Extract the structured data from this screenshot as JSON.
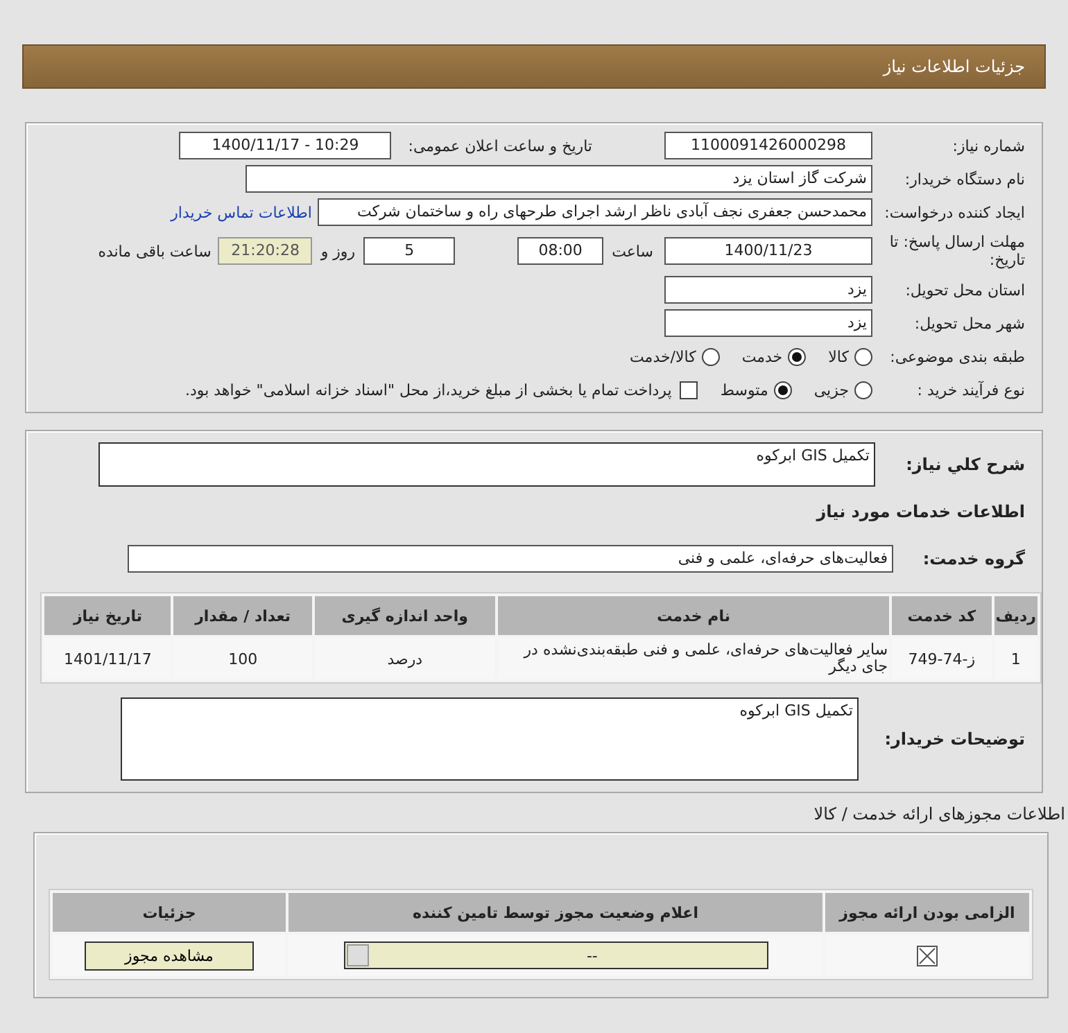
{
  "header": {
    "title": "جزئیات اطلاعات نیاز"
  },
  "details": {
    "need_number": {
      "label": "شماره نیاز:",
      "value": "1100091426000298"
    },
    "announce": {
      "label": "تاریخ و ساعت اعلان عمومی:",
      "value": "1400/11/17 - 10:29"
    },
    "buyer_org": {
      "label": "نام دستگاه خریدار:",
      "value": "شرکت گاز استان یزد"
    },
    "requester": {
      "label": "ایجاد کننده درخواست:",
      "value": "محمدحسن جعفری نجف آبادی ناظر ارشد اجرای طرحهای راه و ساختمان شرکت",
      "link": "اطلاعات تماس خریدار"
    },
    "deadline": {
      "label": "مهلت ارسال پاسخ: تا تاریخ:",
      "date": "1400/11/23",
      "time_label": "ساعت",
      "time": "08:00",
      "days": "5",
      "days_label": "روز و",
      "remaining": "21:20:28",
      "remaining_label": "ساعت باقی مانده"
    },
    "province": {
      "label": "استان محل تحویل:",
      "value": "یزد"
    },
    "city": {
      "label": "شهر محل تحویل:",
      "value": "یزد"
    },
    "category": {
      "label": "طبقه بندی موضوعی:",
      "options": [
        {
          "label": "کالا",
          "selected": false
        },
        {
          "label": "خدمت",
          "selected": true
        },
        {
          "label": "کالا/خدمت",
          "selected": false
        }
      ]
    },
    "process": {
      "label": "نوع فرآیند خرید :",
      "options": [
        {
          "label": "جزیی",
          "selected": false
        },
        {
          "label": "متوسط",
          "selected": true
        }
      ],
      "treasury": {
        "checked": false,
        "label": "پرداخت تمام یا بخشی از مبلغ خرید،از محل \"اسناد خزانه اسلامی\" خواهد بود."
      }
    }
  },
  "needs": {
    "summary": {
      "label": "شرح کلي نياز:",
      "value": "تکمیل GIS ابرکوه"
    },
    "heading": "اطلاعات خدمات مورد نیاز",
    "service_group": {
      "label": "گروه خدمت:",
      "value": "فعالیت‌های حرفه‌ای، علمی و فنی"
    },
    "table": {
      "columns": [
        "ردیف",
        "کد خدمت",
        "نام خدمت",
        "واحد اندازه گیری",
        "تعداد / مقدار",
        "تاریخ نیاز"
      ],
      "rows": [
        [
          "1",
          "ز-74-749",
          "سایر فعالیت‌های حرفه‌ای، علمی و فنی طبقه‌بندی‌نشده در جای دیگر",
          "درصد",
          "100",
          "1401/11/17"
        ]
      ]
    },
    "buyer_notes": {
      "label": "توضیحات خریدار:",
      "value": "تکمیل GIS ابرکوه"
    }
  },
  "permits": {
    "title": "اطلاعات مجوزهای ارائه خدمت / کالا",
    "columns": [
      "الزامی بودن ارائه مجوز",
      "اعلام وضعیت مجوز توسط تامین کننده",
      "جزئیات"
    ],
    "rows": [
      {
        "required": true,
        "status": "--",
        "action": "مشاهده مجوز"
      }
    ]
  }
}
